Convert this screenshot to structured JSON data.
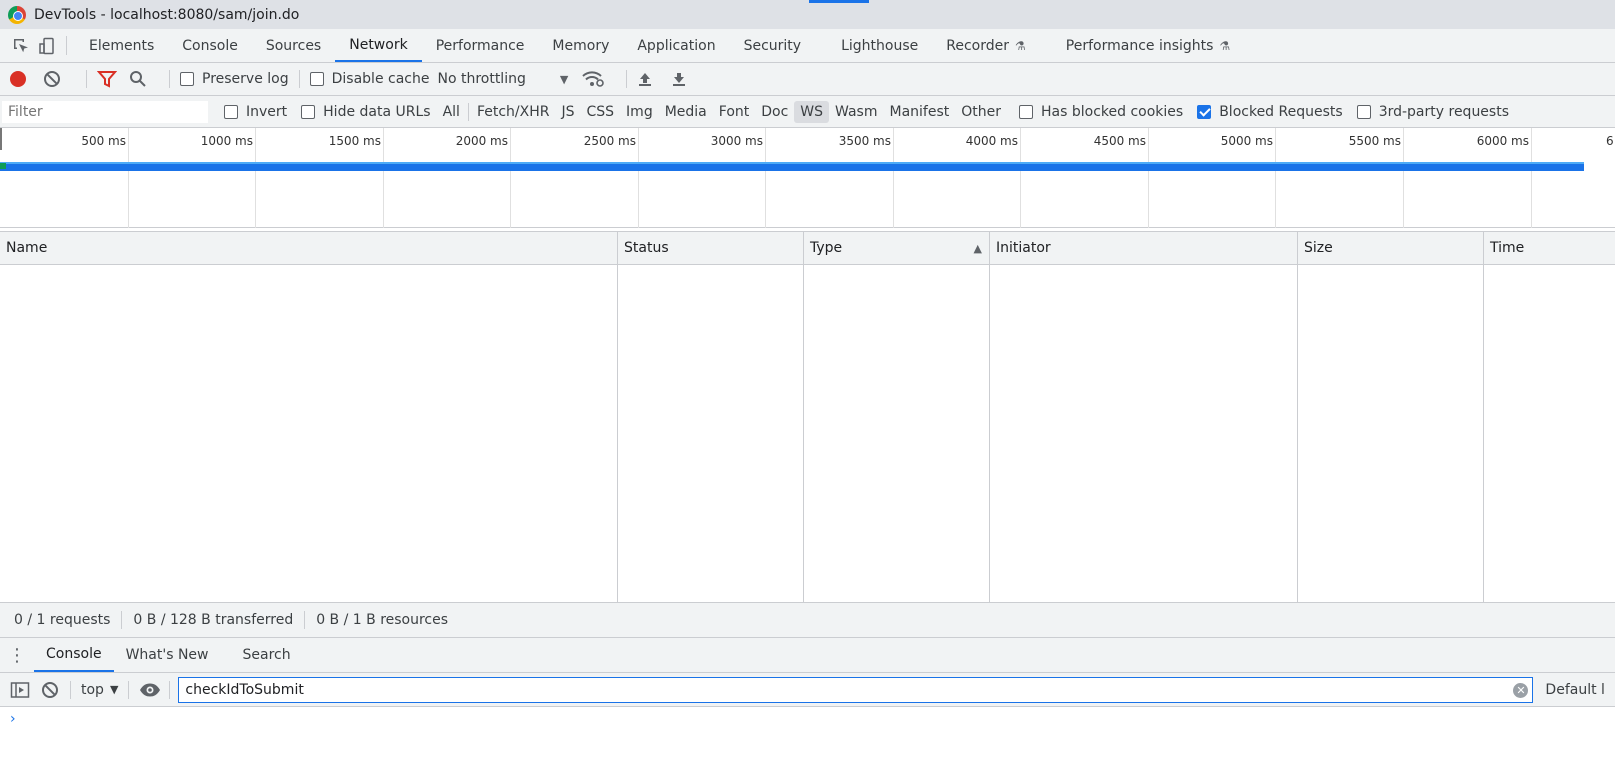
{
  "window": {
    "title": "DevTools - localhost:8080/sam/join.do"
  },
  "tabs": [
    {
      "label": "Elements"
    },
    {
      "label": "Console"
    },
    {
      "label": "Sources"
    },
    {
      "label": "Network"
    },
    {
      "label": "Performance"
    },
    {
      "label": "Memory"
    },
    {
      "label": "Application"
    },
    {
      "label": "Security"
    },
    {
      "label": "Lighthouse"
    },
    {
      "label": "Recorder"
    },
    {
      "label": "Performance insights"
    }
  ],
  "active_tab": "Network",
  "toolbar": {
    "preserve_log": "Preserve log",
    "disable_cache": "Disable cache",
    "throttling": "No throttling"
  },
  "filter": {
    "placeholder": "Filter",
    "invert": "Invert",
    "hide_data_urls": "Hide data URLs",
    "types": [
      "All",
      "Fetch/XHR",
      "JS",
      "CSS",
      "Img",
      "Media",
      "Font",
      "Doc",
      "WS",
      "Wasm",
      "Manifest",
      "Other"
    ],
    "active_type": "WS",
    "has_blocked_cookies": "Has blocked cookies",
    "blocked_requests": "Blocked Requests",
    "blocked_requests_checked": true,
    "third_party": "3rd-party requests"
  },
  "timeline": {
    "ticks": [
      "500 ms",
      "1000 ms",
      "1500 ms",
      "2000 ms",
      "2500 ms",
      "3000 ms",
      "3500 ms",
      "4000 ms",
      "4500 ms",
      "5000 ms",
      "5500 ms",
      "6000 ms"
    ],
    "overflow_tick": "6"
  },
  "table": {
    "columns": [
      "Name",
      "Status",
      "Type",
      "Initiator",
      "Size",
      "Time"
    ]
  },
  "status": {
    "requests": "0 / 1 requests",
    "transferred": "0 B / 128 B transferred",
    "resources": "0 B / 1 B resources"
  },
  "drawer": {
    "tabs": [
      "Console",
      "What's New",
      "Search"
    ],
    "context": "top",
    "input_value": "checkIdToSubmit",
    "levels": "Default l",
    "prompt": "›"
  },
  "colors": {
    "accent": "#1a73e8",
    "record": "#d93025",
    "underline": "#d93025"
  }
}
